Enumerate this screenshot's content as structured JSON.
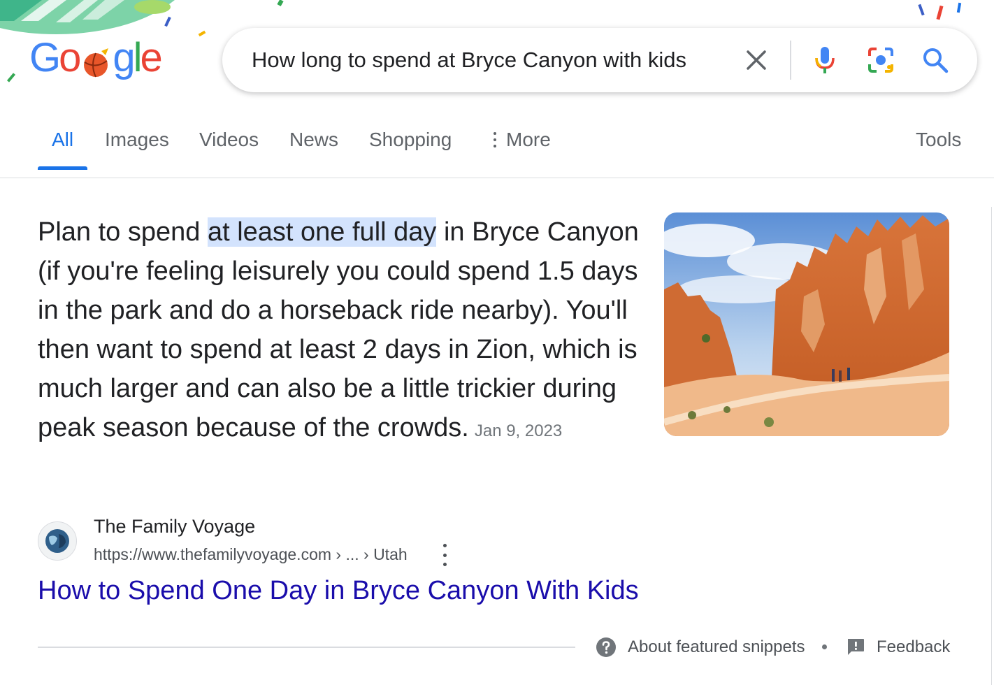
{
  "colors": {
    "accent": "#1a73e8",
    "link": "#1a0dab",
    "highlight": "#d3e3fd",
    "text": "#202124",
    "muted": "#70757a"
  },
  "logo": {
    "letters": [
      "G",
      "o",
      "",
      "g",
      "l",
      "e"
    ],
    "alt_icon": "basketball-doodle-icon"
  },
  "search": {
    "query": "How long to spend at Bryce Canyon with kids",
    "icons": [
      "clear-icon",
      "mic-icon",
      "lens-icon",
      "search-icon"
    ]
  },
  "tabs": [
    {
      "label": "All",
      "active": true
    },
    {
      "label": "Images",
      "active": false
    },
    {
      "label": "Videos",
      "active": false
    },
    {
      "label": "News",
      "active": false
    },
    {
      "label": "Shopping",
      "active": false
    }
  ],
  "more_label": "More",
  "tools_label": "Tools",
  "snippet": {
    "pre": "Plan to spend ",
    "highlight": "at least one full day",
    "post": " in Bryce Canyon (if you're feeling leisurely you could spend 1.5 days in the park and do a horseback ride nearby). You'll then want to spend at least 2 days in Zion, which is much larger and can also be a little trickier during peak season because of the crowds.",
    "date": "Jan 9, 2023"
  },
  "source": {
    "name": "The Family Voyage",
    "url": "https://www.thefamilyvoyage.com › ... › Utah"
  },
  "result_title": "How to Spend One Day in Bryce Canyon With Kids",
  "footer": {
    "about": "About featured snippets",
    "feedback": "Feedback"
  }
}
